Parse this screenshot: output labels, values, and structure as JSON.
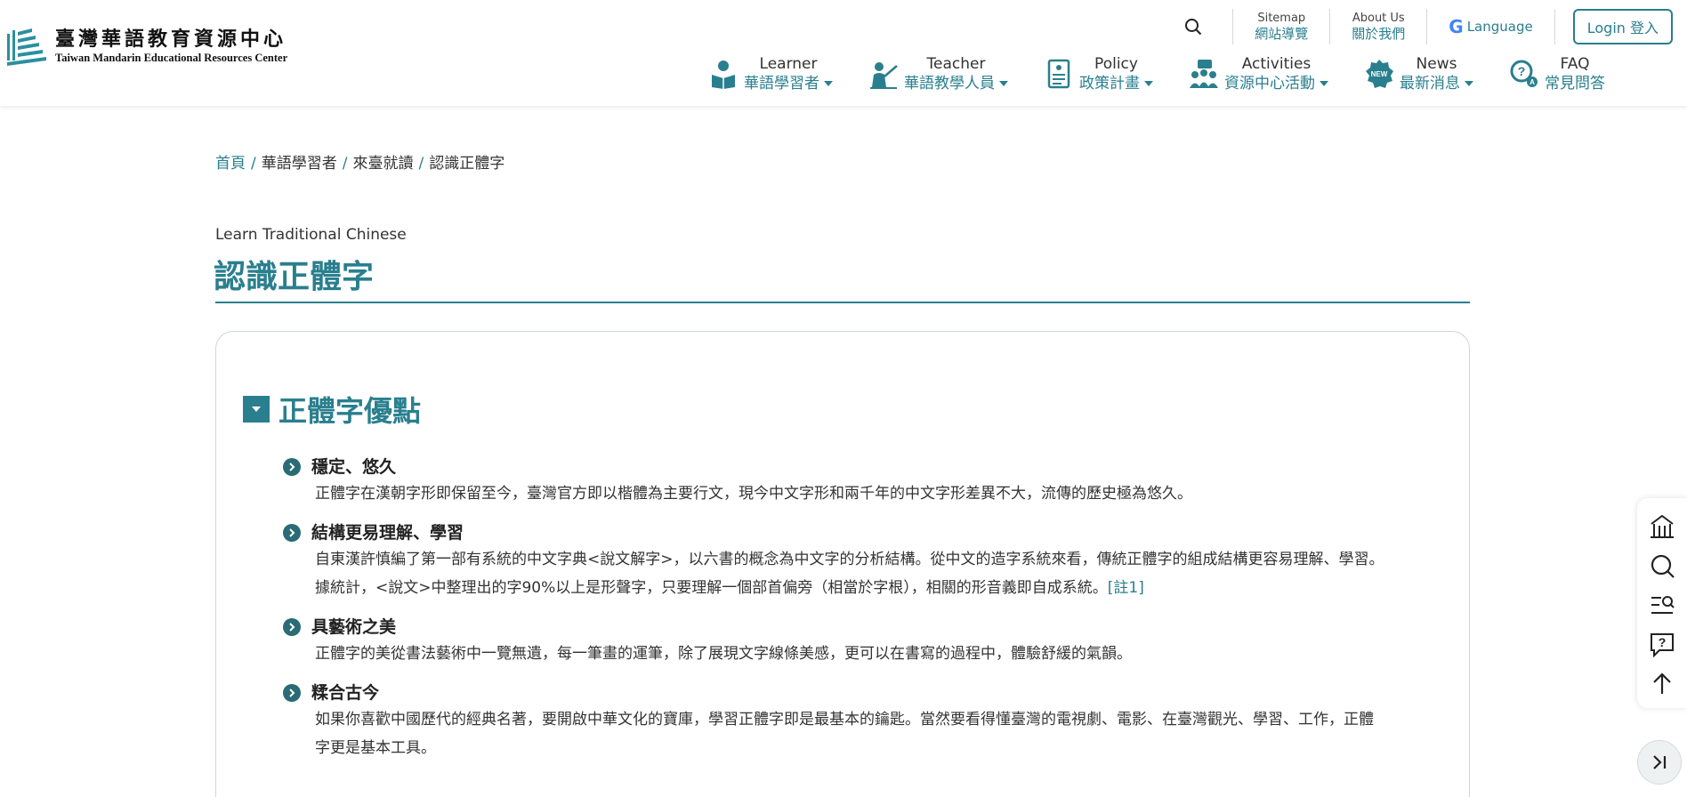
{
  "header": {
    "logo_zh": "臺灣華語教育資源中心",
    "logo_en": "Taiwan Mandarin Educational Resources Center",
    "util": {
      "sitemap_en": "Sitemap",
      "sitemap_zh": "網站導覽",
      "about_en": "About Us",
      "about_zh": "關於我們",
      "language": "Language",
      "login": "Login 登入"
    },
    "nav": [
      {
        "en": "Learner",
        "zh": "華語學習者",
        "icon": "reader-icon"
      },
      {
        "en": "Teacher",
        "zh": "華語教學人員",
        "icon": "teacher-icon"
      },
      {
        "en": "Policy",
        "zh": "政策計畫",
        "icon": "document-icon"
      },
      {
        "en": "Activities",
        "zh": "資源中心活動",
        "icon": "people-icon"
      },
      {
        "en": "News",
        "zh": "最新消息",
        "icon": "new-badge-icon"
      },
      {
        "en": "FAQ",
        "zh": "常見問答",
        "icon": "question-search-icon"
      }
    ]
  },
  "breadcrumb": {
    "items": [
      "首頁",
      "華語學習者",
      "來臺就讀",
      "認識正體字"
    ],
    "separator": "/"
  },
  "page": {
    "subtitle": "Learn Traditional Chinese",
    "title": "認識正體字"
  },
  "section": {
    "title": "正體字優點",
    "points": [
      {
        "title": "穩定、悠久",
        "body": "正體字在漢朝字形即保留至今，臺灣官方即以楷體為主要行文，現今中文字形和兩千年的中文字形差異不大，流傳的歷史極為悠久。"
      },
      {
        "title": "結構更易理解、學習",
        "body": "自東漢許慎編了第一部有系統的中文字典<說文解字>，以六書的概念為中文字的分析結構。從中文的造字系統來看，傳統正體字的組成結構更容易理解、學習。",
        "body2": "據統計，<說文>中整理出的字90%以上是形聲字，只要理解一個部首偏旁（相當於字根），相關的形音義即自成系統。",
        "note": "[註1]"
      },
      {
        "title": "具藝術之美",
        "body": "正體字的美從書法藝術中一覽無遺，每一筆畫的運筆，除了展現文字線條美感，更可以在書寫的過程中，體驗舒緩的氣韻。"
      },
      {
        "title": "糅合古今",
        "body": "如果你喜歡中國歷代的經典名著，要開啟中華文化的寶庫，學習正體字即是最基本的鑰匙。當然要看得懂臺灣的電視劇、電影、在臺灣觀光、學習、工作，正體",
        "body2": "字更是基本工具。"
      }
    ]
  },
  "side_tools": [
    "home-icon",
    "search-icon",
    "list-search-icon",
    "question-icon",
    "arrow-up-icon"
  ],
  "colors": {
    "accent": "#2a7f8e",
    "bullet": "#2a6b75",
    "text": "#222222"
  }
}
